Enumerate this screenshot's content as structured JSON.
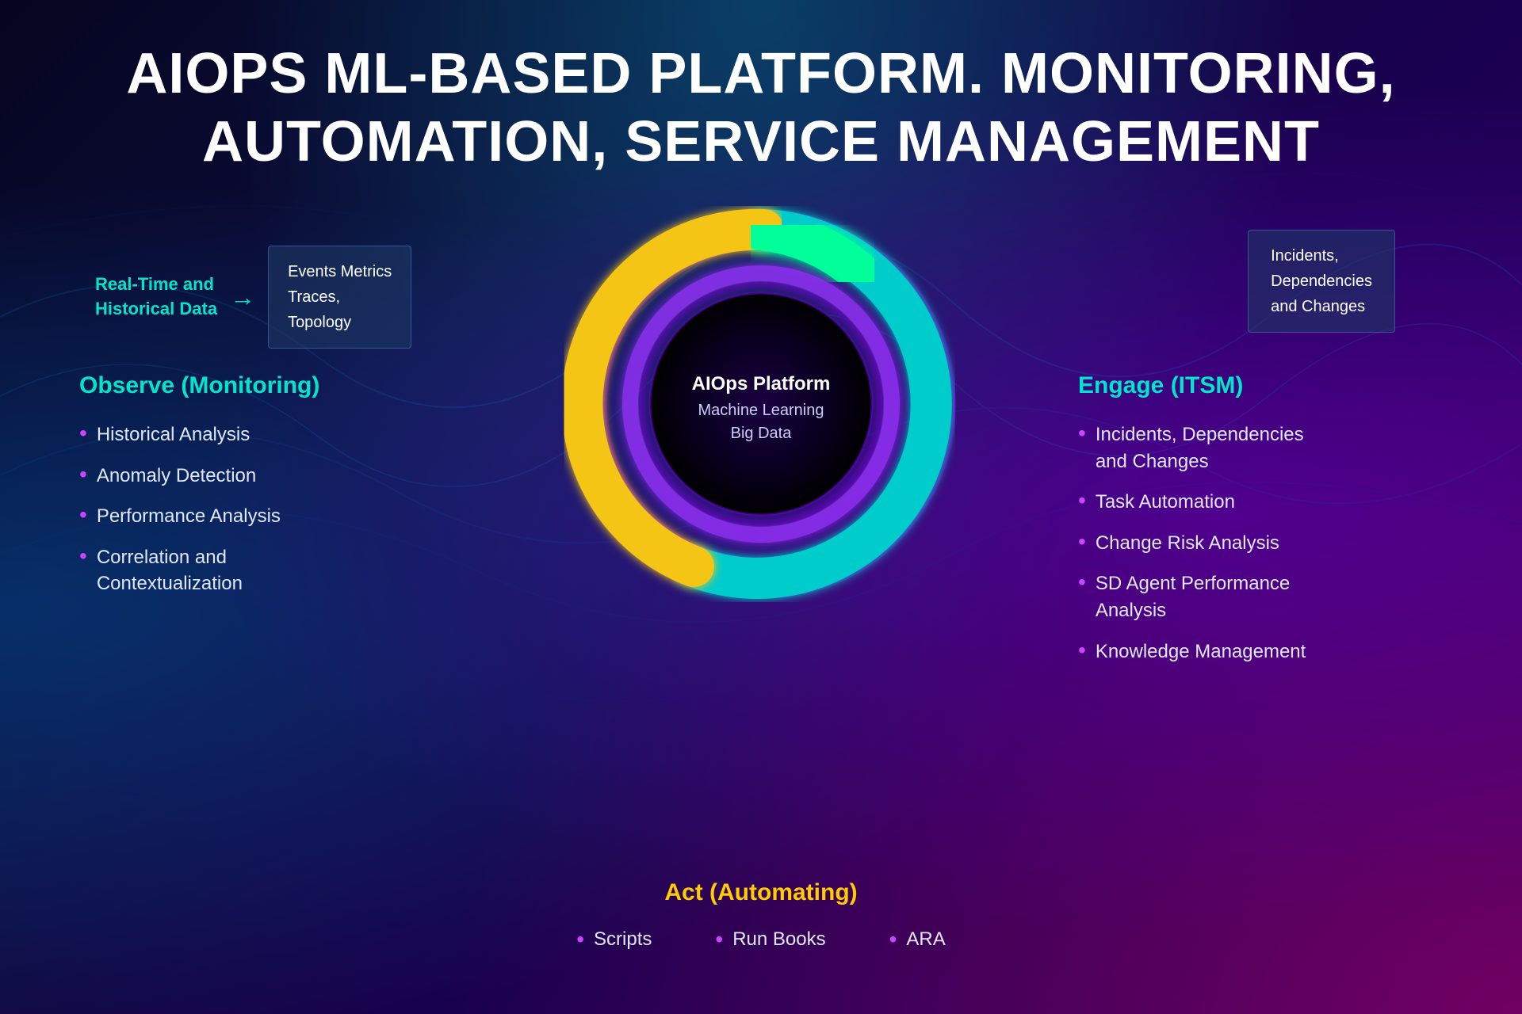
{
  "header": {
    "title_line1": "AIOPS ML-BASED PLATFORM. MONITORING,",
    "title_line2": "AUTOMATION, SERVICE MANAGEMENT"
  },
  "data_flow": {
    "label_line1": "Real-Time and",
    "label_line2": "Historical Data",
    "arrow": "→",
    "box_line1": "Events Metrics",
    "box_line2": "Traces,",
    "box_line3": "Topology"
  },
  "incidents_box": {
    "line1": "Incidents,",
    "line2": "Dependencies",
    "line3": "and Changes"
  },
  "observe": {
    "title": "Observe (Monitoring)",
    "items": [
      "Historical Analysis",
      "Anomaly Detection",
      "Performance Analysis",
      "Correlation and\nContextualization"
    ]
  },
  "center": {
    "platform_name": "AIOps Platform",
    "sub1": "Machine Learning",
    "sub2": "Big Data"
  },
  "engage": {
    "title": "Engage (ITSM)",
    "items": [
      "Incidents, Dependencies\nand Changes",
      "Task Automation",
      "Change Risk Analysis",
      "SD Agent Performance\nAnalysis",
      "Knowledge Management"
    ]
  },
  "act": {
    "title": "Act (Automating)",
    "items": [
      "Scripts",
      "Run Books",
      "ARA"
    ]
  },
  "colors": {
    "cyan": "#00e5cc",
    "yellow": "#ffcc00",
    "purple_bullet": "#cc44ff",
    "white": "#ffffff",
    "light_blue_text": "#e0e8ff",
    "donut_cyan": "#00d4d4",
    "donut_purple": "#9b30ff",
    "donut_yellow": "#f5c518",
    "donut_green": "#00ff99"
  }
}
